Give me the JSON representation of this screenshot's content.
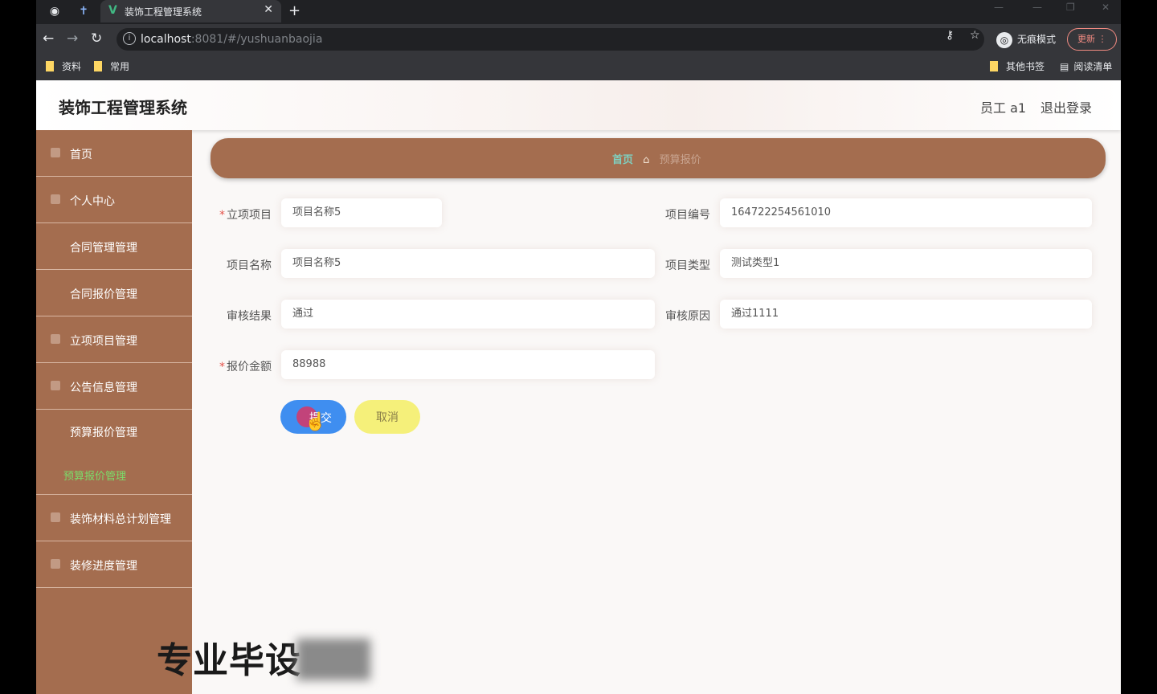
{
  "browser": {
    "tab_title": "装饰工程管理系统",
    "url_host": "localhost",
    "url_path": ":8081/#/yushuanbaojia",
    "profile_label": "无痕模式",
    "update_label": "更新",
    "bookmarks": [
      "资料",
      "常用"
    ],
    "bookmarks_right": [
      "其他书签",
      "阅读清单"
    ]
  },
  "app": {
    "title": "装饰工程管理系统",
    "user_label": "员工 a1",
    "logout_label": "退出登录"
  },
  "sidebar": {
    "items": [
      {
        "label": "首页"
      },
      {
        "label": "个人中心"
      },
      {
        "label": "合同管理管理"
      },
      {
        "label": "合同报价管理"
      },
      {
        "label": "立项项目管理"
      },
      {
        "label": "公告信息管理"
      },
      {
        "label": "预算报价管理",
        "sub": "预算报价管理"
      },
      {
        "label": "装饰材料总计划管理"
      },
      {
        "label": "装修进度管理"
      }
    ]
  },
  "breadcrumb": {
    "home": "首页",
    "current": "预算报价"
  },
  "form": {
    "lixiang_label": "立项项目",
    "lixiang_value": "项目名称5",
    "bianhao_label": "项目编号",
    "bianhao_value": "164722254561010",
    "mingcheng_label": "项目名称",
    "mingcheng_value": "项目名称5",
    "leixing_label": "项目类型",
    "leixing_value": "测试类型1",
    "jieguo_label": "审核结果",
    "jieguo_value": "通过",
    "yuanyin_label": "审核原因",
    "yuanyin_value": "通过1111",
    "jine_label": "报价金额",
    "jine_value": "88988",
    "required_mark": "*",
    "submit_label": "提交",
    "cancel_label": "取消"
  },
  "watermark": {
    "text": "专业毕设"
  }
}
